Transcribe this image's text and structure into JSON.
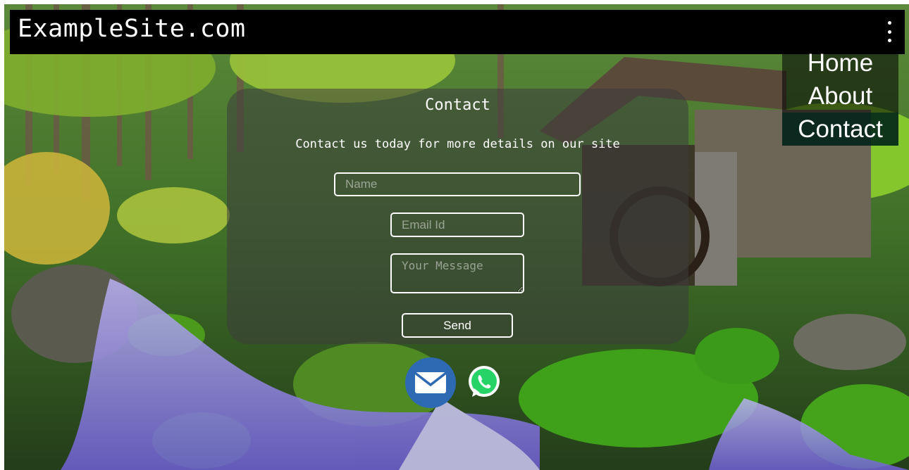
{
  "header": {
    "site_title": "ExampleSite.com",
    "menu_icon": "more-vertical-icon"
  },
  "nav": {
    "items": [
      {
        "label": "Home"
      },
      {
        "label": "About"
      },
      {
        "label": "Contact"
      }
    ],
    "active": "Contact"
  },
  "contact": {
    "title": "Contact",
    "subtitle": "Contact us today for more details on our site",
    "name_placeholder": "Name",
    "email_placeholder": "Email Id",
    "message_placeholder": "Your Message",
    "send_label": "Send"
  },
  "social": {
    "mail_icon": "envelope-icon",
    "whatsapp_icon": "whatsapp-icon",
    "mail_color": "#2e69b3",
    "whatsapp_color": "#25d366"
  },
  "background_image": "forest waterfall with watermill"
}
